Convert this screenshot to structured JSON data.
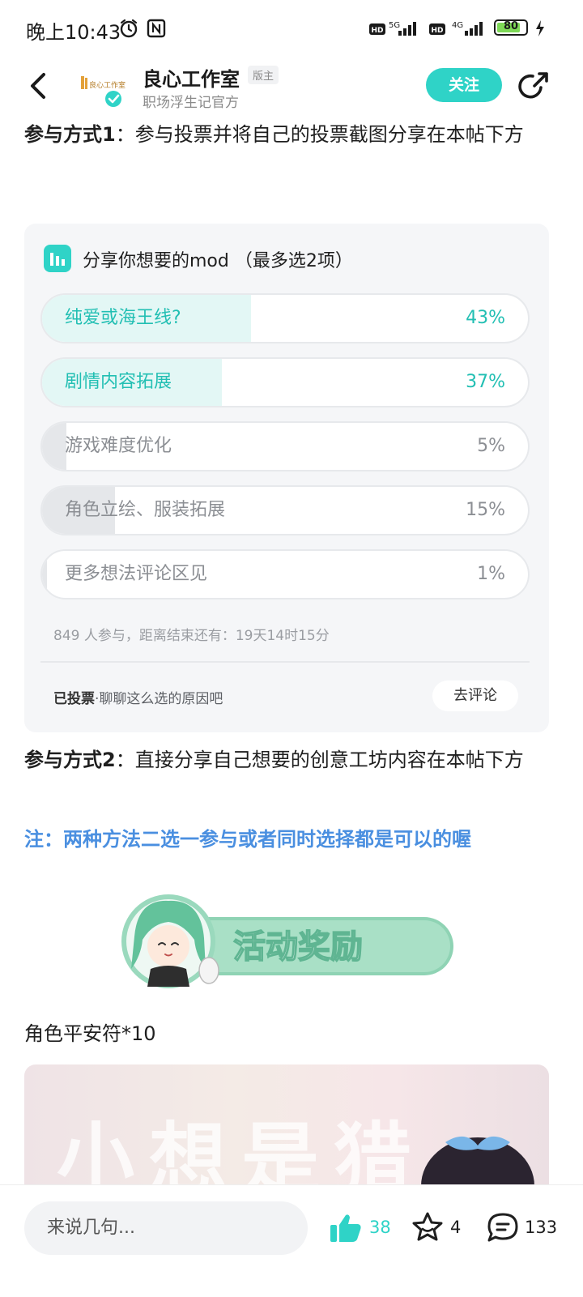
{
  "status_bar": {
    "time": "晚上10:43",
    "network1": "5G",
    "network2": "4G",
    "battery": "80"
  },
  "header": {
    "studio_name": "良心工作室",
    "badge": "版主",
    "subtitle": "职场浮生记官方",
    "follow_label": "关注",
    "avatar_text": "良心工作室"
  },
  "post": {
    "method1_label": "参与方式1",
    "method1_text": "：参与投票并将自己的投票截图分享在本帖下方",
    "method2_label": "参与方式2",
    "method2_text": "：直接分享自己想要的创意工坊内容在本帖下方",
    "note": "注：两种方法二选一参与或者同时选择都是可以的喔",
    "banner_text": "活动奖励",
    "reward_line": "角色平安符*10",
    "preview_text": "小想是猎"
  },
  "poll": {
    "title": "分享你想要的mod （最多选2项）",
    "options": [
      {
        "label": "纯爱或海王线?",
        "percent": "43%",
        "value": 0.43
      },
      {
        "label": "剧情内容拓展",
        "percent": "37%",
        "value": 0.37
      },
      {
        "label": "游戏难度优化",
        "percent": "5%",
        "value": 0.05
      },
      {
        "label": "角色立绘、服装拓展",
        "percent": "15%",
        "value": 0.15
      },
      {
        "label": "更多想法评论区见",
        "percent": "1%",
        "value": 0.01
      }
    ],
    "meta": "849 人参与，距离结束还有：19天14时15分",
    "voted_label": "已投票",
    "voted_hint": "·聊聊这么选的原因吧",
    "comment_button": "去评论"
  },
  "bottom_bar": {
    "input_placeholder": "来说几句...",
    "like_count": "38",
    "star_count": "4",
    "comment_count": "133"
  },
  "colors": {
    "accent": "#2fd3c7",
    "note_blue": "#4a8fe0"
  }
}
